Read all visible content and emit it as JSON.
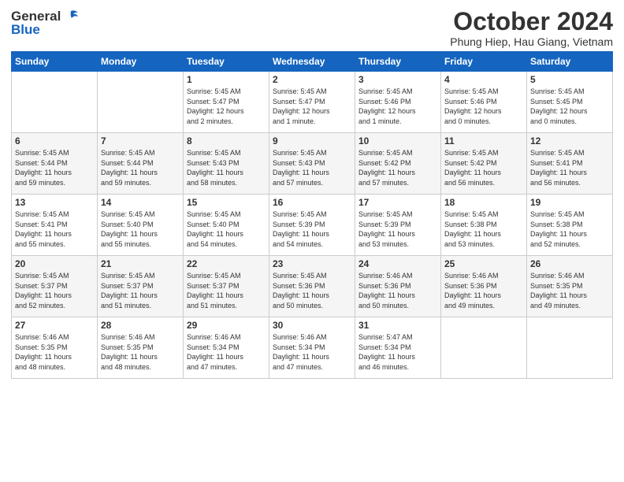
{
  "header": {
    "logo_general": "General",
    "logo_blue": "Blue",
    "title": "October 2024",
    "subtitle": "Phung Hiep, Hau Giang, Vietnam"
  },
  "days_of_week": [
    "Sunday",
    "Monday",
    "Tuesday",
    "Wednesday",
    "Thursday",
    "Friday",
    "Saturday"
  ],
  "weeks": [
    [
      {
        "day": "",
        "info": ""
      },
      {
        "day": "",
        "info": ""
      },
      {
        "day": "1",
        "info": "Sunrise: 5:45 AM\nSunset: 5:47 PM\nDaylight: 12 hours\nand 2 minutes."
      },
      {
        "day": "2",
        "info": "Sunrise: 5:45 AM\nSunset: 5:47 PM\nDaylight: 12 hours\nand 1 minute."
      },
      {
        "day": "3",
        "info": "Sunrise: 5:45 AM\nSunset: 5:46 PM\nDaylight: 12 hours\nand 1 minute."
      },
      {
        "day": "4",
        "info": "Sunrise: 5:45 AM\nSunset: 5:46 PM\nDaylight: 12 hours\nand 0 minutes."
      },
      {
        "day": "5",
        "info": "Sunrise: 5:45 AM\nSunset: 5:45 PM\nDaylight: 12 hours\nand 0 minutes."
      }
    ],
    [
      {
        "day": "6",
        "info": "Sunrise: 5:45 AM\nSunset: 5:44 PM\nDaylight: 11 hours\nand 59 minutes."
      },
      {
        "day": "7",
        "info": "Sunrise: 5:45 AM\nSunset: 5:44 PM\nDaylight: 11 hours\nand 59 minutes."
      },
      {
        "day": "8",
        "info": "Sunrise: 5:45 AM\nSunset: 5:43 PM\nDaylight: 11 hours\nand 58 minutes."
      },
      {
        "day": "9",
        "info": "Sunrise: 5:45 AM\nSunset: 5:43 PM\nDaylight: 11 hours\nand 57 minutes."
      },
      {
        "day": "10",
        "info": "Sunrise: 5:45 AM\nSunset: 5:42 PM\nDaylight: 11 hours\nand 57 minutes."
      },
      {
        "day": "11",
        "info": "Sunrise: 5:45 AM\nSunset: 5:42 PM\nDaylight: 11 hours\nand 56 minutes."
      },
      {
        "day": "12",
        "info": "Sunrise: 5:45 AM\nSunset: 5:41 PM\nDaylight: 11 hours\nand 56 minutes."
      }
    ],
    [
      {
        "day": "13",
        "info": "Sunrise: 5:45 AM\nSunset: 5:41 PM\nDaylight: 11 hours\nand 55 minutes."
      },
      {
        "day": "14",
        "info": "Sunrise: 5:45 AM\nSunset: 5:40 PM\nDaylight: 11 hours\nand 55 minutes."
      },
      {
        "day": "15",
        "info": "Sunrise: 5:45 AM\nSunset: 5:40 PM\nDaylight: 11 hours\nand 54 minutes."
      },
      {
        "day": "16",
        "info": "Sunrise: 5:45 AM\nSunset: 5:39 PM\nDaylight: 11 hours\nand 54 minutes."
      },
      {
        "day": "17",
        "info": "Sunrise: 5:45 AM\nSunset: 5:39 PM\nDaylight: 11 hours\nand 53 minutes."
      },
      {
        "day": "18",
        "info": "Sunrise: 5:45 AM\nSunset: 5:38 PM\nDaylight: 11 hours\nand 53 minutes."
      },
      {
        "day": "19",
        "info": "Sunrise: 5:45 AM\nSunset: 5:38 PM\nDaylight: 11 hours\nand 52 minutes."
      }
    ],
    [
      {
        "day": "20",
        "info": "Sunrise: 5:45 AM\nSunset: 5:37 PM\nDaylight: 11 hours\nand 52 minutes."
      },
      {
        "day": "21",
        "info": "Sunrise: 5:45 AM\nSunset: 5:37 PM\nDaylight: 11 hours\nand 51 minutes."
      },
      {
        "day": "22",
        "info": "Sunrise: 5:45 AM\nSunset: 5:37 PM\nDaylight: 11 hours\nand 51 minutes."
      },
      {
        "day": "23",
        "info": "Sunrise: 5:45 AM\nSunset: 5:36 PM\nDaylight: 11 hours\nand 50 minutes."
      },
      {
        "day": "24",
        "info": "Sunrise: 5:46 AM\nSunset: 5:36 PM\nDaylight: 11 hours\nand 50 minutes."
      },
      {
        "day": "25",
        "info": "Sunrise: 5:46 AM\nSunset: 5:36 PM\nDaylight: 11 hours\nand 49 minutes."
      },
      {
        "day": "26",
        "info": "Sunrise: 5:46 AM\nSunset: 5:35 PM\nDaylight: 11 hours\nand 49 minutes."
      }
    ],
    [
      {
        "day": "27",
        "info": "Sunrise: 5:46 AM\nSunset: 5:35 PM\nDaylight: 11 hours\nand 48 minutes."
      },
      {
        "day": "28",
        "info": "Sunrise: 5:46 AM\nSunset: 5:35 PM\nDaylight: 11 hours\nand 48 minutes."
      },
      {
        "day": "29",
        "info": "Sunrise: 5:46 AM\nSunset: 5:34 PM\nDaylight: 11 hours\nand 47 minutes."
      },
      {
        "day": "30",
        "info": "Sunrise: 5:46 AM\nSunset: 5:34 PM\nDaylight: 11 hours\nand 47 minutes."
      },
      {
        "day": "31",
        "info": "Sunrise: 5:47 AM\nSunset: 5:34 PM\nDaylight: 11 hours\nand 46 minutes."
      },
      {
        "day": "",
        "info": ""
      },
      {
        "day": "",
        "info": ""
      }
    ]
  ]
}
